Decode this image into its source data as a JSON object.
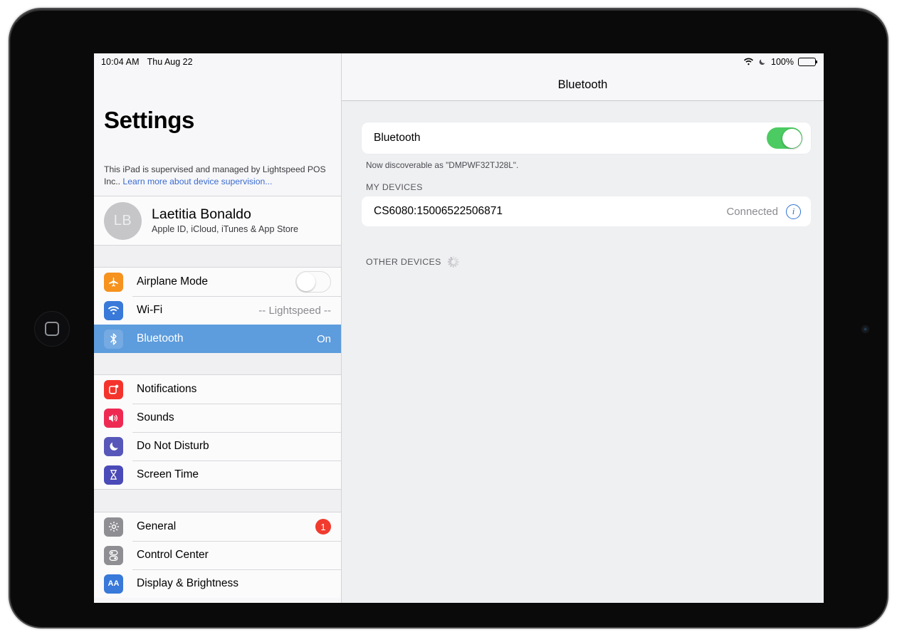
{
  "statusbar": {
    "time": "10:04 AM",
    "date": "Thu Aug 22",
    "wifi_icon": "wifi-icon",
    "dnd_icon": "moon-icon",
    "battery_percent": "100%",
    "battery_icon": "battery-full-icon"
  },
  "sidebar": {
    "title": "Settings",
    "supervision": {
      "text": "This iPad is supervised and managed by Lightspeed POS Inc..",
      "link": "Learn more about device supervision..."
    },
    "account": {
      "initials": "LB",
      "name": "Laetitia Bonaldo",
      "subtitle": "Apple ID, iCloud, iTunes & App Store"
    },
    "group1": [
      {
        "label": "Airplane Mode",
        "icon": "airplane-icon",
        "icon_color": "#f6921e",
        "control": "toggle",
        "toggle_on": false
      },
      {
        "label": "Wi-Fi",
        "icon": "wifi-icon",
        "icon_color": "#3879d9",
        "value": "--  Lightspeed  --"
      },
      {
        "label": "Bluetooth",
        "icon": "bluetooth-icon",
        "icon_color": "#3879d9",
        "value": "On",
        "selected": true
      }
    ],
    "group2": [
      {
        "label": "Notifications",
        "icon": "notifications-icon",
        "icon_color": "#f4342c"
      },
      {
        "label": "Sounds",
        "icon": "speaker-icon",
        "icon_color": "#ee2a53"
      },
      {
        "label": "Do Not Disturb",
        "icon": "moon-icon",
        "icon_color": "#5757b9"
      },
      {
        "label": "Screen Time",
        "icon": "hourglass-icon",
        "icon_color": "#4a4ab8"
      }
    ],
    "group3": [
      {
        "label": "General",
        "icon": "gear-icon",
        "icon_color": "#8e8e93",
        "badge": "1"
      },
      {
        "label": "Control Center",
        "icon": "sliders-icon",
        "icon_color": "#8e8e93"
      },
      {
        "label": "Display & Brightness",
        "icon": "text-size-icon",
        "icon_color": "#3879d9"
      }
    ]
  },
  "detail": {
    "header_title": "Bluetooth",
    "bluetooth_label": "Bluetooth",
    "bluetooth_on": true,
    "discoverable_text": "Now discoverable as \"DMPWF32TJ28L\".",
    "my_devices_header": "MY DEVICES",
    "devices": [
      {
        "name": "CS6080:15006522506871",
        "status": "Connected",
        "info_icon": "info-icon"
      }
    ],
    "other_devices_header": "OTHER DEVICES",
    "scanning_icon": "spinner-icon"
  },
  "colors": {
    "accent_blue": "#3879d9",
    "selected_row": "#5d9cdd",
    "toggle_green": "#4ccb62",
    "badge_red": "#f03b2e",
    "link_blue": "#3a6bd0"
  }
}
